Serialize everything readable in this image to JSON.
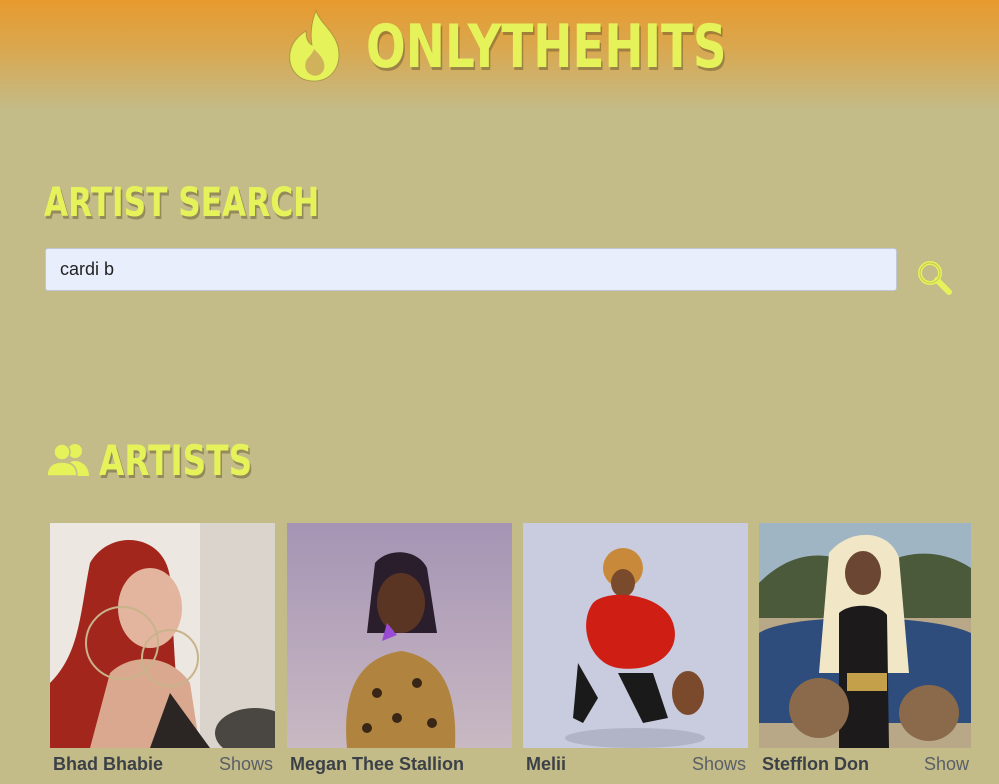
{
  "header": {
    "brand_icon": "flame-icon",
    "title": "ONLYTHEHITS"
  },
  "search": {
    "title": "ARTIST SEARCH",
    "value": "cardi b",
    "button_icon": "search-icon"
  },
  "artists": {
    "title": "ARTISTS",
    "icon": "users-icon",
    "items": [
      {
        "name": "Bhad Bhabie",
        "shows_label": "Shows"
      },
      {
        "name": "Megan Thee Stallion",
        "shows_label": ""
      },
      {
        "name": "Melii",
        "shows_label": "Shows"
      },
      {
        "name": "Stefflon Don",
        "shows_label": "Show"
      }
    ]
  },
  "colors": {
    "background": "#c3bb88",
    "accent": "#e6f25a",
    "header_top": "#e89a2e"
  }
}
